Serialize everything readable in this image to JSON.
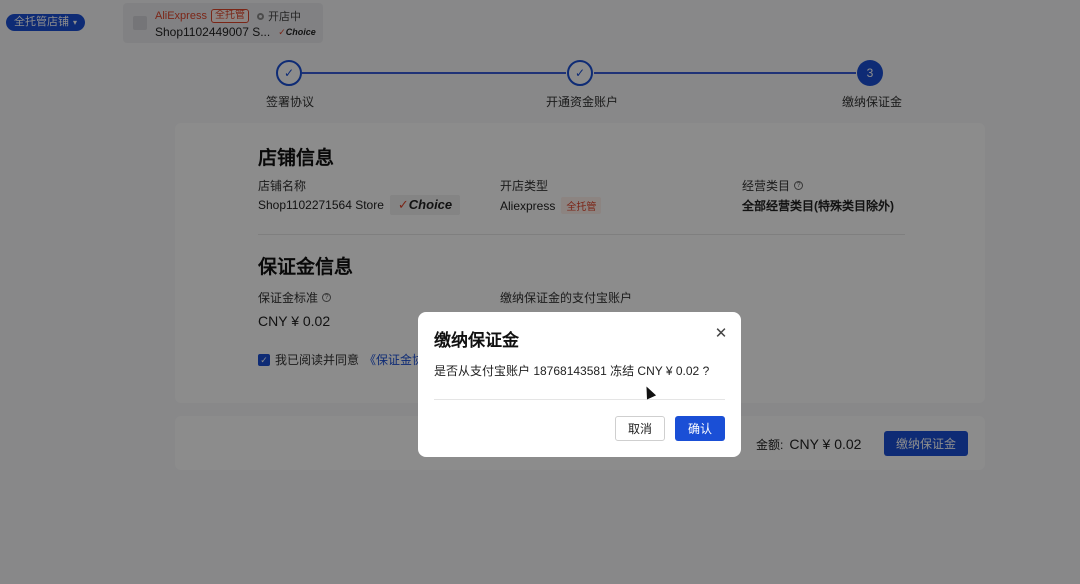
{
  "topbar": {
    "store_switch_label": "全托管店铺",
    "shop": {
      "brand": "AliExpress",
      "tag": "全托管",
      "status": "开店中",
      "name": "Shop1102449007 S...",
      "choice": "Choice"
    }
  },
  "steps": [
    {
      "label": "签署协议",
      "state": "done"
    },
    {
      "label": "开通资金账户",
      "state": "done"
    },
    {
      "label": "缴纳保证金",
      "state": "active",
      "number": "3"
    }
  ],
  "store_info": {
    "title": "店铺信息",
    "name_label": "店铺名称",
    "name_value": "Shop1102271564 Store",
    "choice_badge": "Choice",
    "type_label": "开店类型",
    "type_value": "Aliexpress",
    "type_tag": "全托管",
    "category_label": "经营类目",
    "category_value": "全部经营类目(特殊类目除外)"
  },
  "deposit_info": {
    "title": "保证金信息",
    "standard_label": "保证金标准",
    "standard_value": "CNY ¥ 0.02",
    "account_label": "缴纳保证金的支付宝账户",
    "agree_text": "我已阅读并同意",
    "agree_link": "《保证金协议"
  },
  "footer": {
    "amount_label": "金额:",
    "amount_value": "CNY ¥ 0.02",
    "pay_button": "缴纳保证金"
  },
  "modal": {
    "title": "缴纳保证金",
    "message": "是否从支付宝账户 18768143581 冻结 CNY ¥ 0.02 ?",
    "cancel": "取消",
    "confirm": "确认"
  },
  "colors": {
    "accent": "#1a4fd6",
    "brand_red": "#e0452b"
  }
}
